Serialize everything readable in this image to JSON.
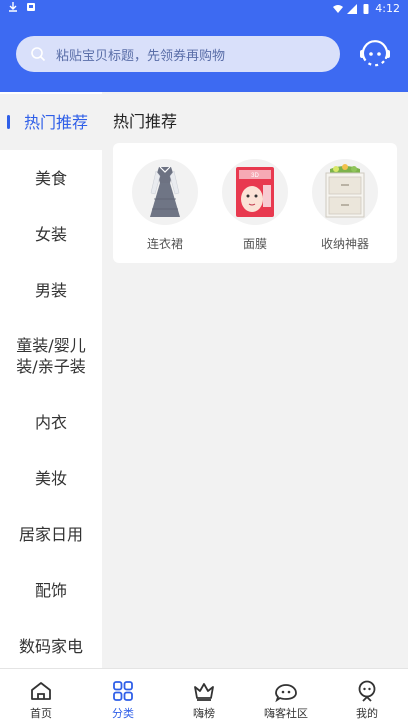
{
  "status_bar": {
    "time": "4:12"
  },
  "search": {
    "placeholder": "粘贴宝贝标题，先领券再购物"
  },
  "sidebar": {
    "items": [
      {
        "label": "热门推荐",
        "active": true
      },
      {
        "label": "美食"
      },
      {
        "label": "女装"
      },
      {
        "label": "男装"
      },
      {
        "label": "童装/婴儿装/亲子装"
      },
      {
        "label": "内衣"
      },
      {
        "label": "美妆"
      },
      {
        "label": "居家日用"
      },
      {
        "label": "配饰"
      },
      {
        "label": "数码家电"
      }
    ]
  },
  "main": {
    "section_title": "热门推荐",
    "products": [
      {
        "name": "连衣裙",
        "icon": "dress-image"
      },
      {
        "name": "面膜",
        "icon": "face-mask-image"
      },
      {
        "name": "收纳神器",
        "icon": "storage-box-image"
      }
    ]
  },
  "tabbar": {
    "tabs": [
      {
        "label": "首页",
        "icon": "home-icon"
      },
      {
        "label": "分类",
        "icon": "category-icon",
        "active": true
      },
      {
        "label": "嗨榜",
        "icon": "crown-icon"
      },
      {
        "label": "嗨客社区",
        "icon": "community-icon"
      },
      {
        "label": "我的",
        "icon": "profile-icon"
      }
    ]
  },
  "colors": {
    "accent": "#3d6af2",
    "active_text": "#2f5fe8"
  }
}
